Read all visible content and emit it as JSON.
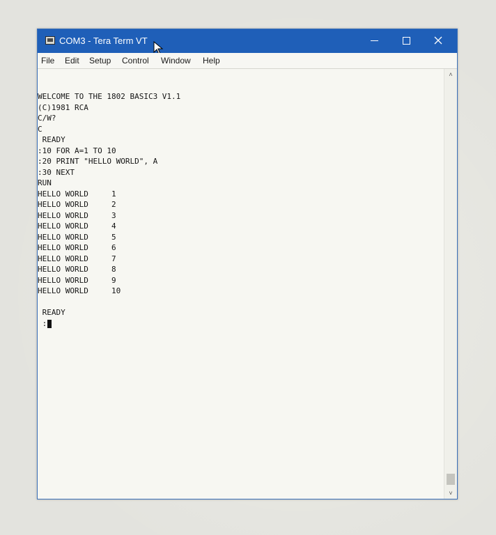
{
  "window": {
    "title": "COM3 - Tera Term VT",
    "icon": "terminal-app-icon",
    "controls": {
      "minimize_icon": "minimize-icon",
      "maximize_icon": "maximize-icon",
      "close_icon": "close-icon"
    }
  },
  "menu": [
    {
      "label": "File"
    },
    {
      "label": "Edit"
    },
    {
      "label": "Setup"
    },
    {
      "label": "Control"
    },
    {
      "label": "Window"
    },
    {
      "label": "Help"
    }
  ],
  "terminal": {
    "lines": [
      "WELCOME TO THE 1802 BASIC3 V1.1",
      "(C)1981 RCA",
      "C/W?",
      "C",
      " READY",
      ":10 FOR A=1 TO 10",
      ":20 PRINT \"HELLO WORLD\", A",
      ":30 NEXT",
      "RUN",
      "HELLO WORLD     1",
      "HELLO WORLD     2",
      "HELLO WORLD     3",
      "HELLO WORLD     4",
      "HELLO WORLD     5",
      "HELLO WORLD     6",
      "HELLO WORLD     7",
      "HELLO WORLD     8",
      "HELLO WORLD     9",
      "HELLO WORLD     10",
      "",
      " READY",
      " :"
    ]
  },
  "scrollbar": {
    "up_icon": "scroll-up-arrow-icon",
    "down_icon": "scroll-down-arrow-icon"
  },
  "colors": {
    "titlebar": "#1f5fb8",
    "terminal_bg": "#f7f7f2",
    "terminal_fg": "#151515"
  }
}
